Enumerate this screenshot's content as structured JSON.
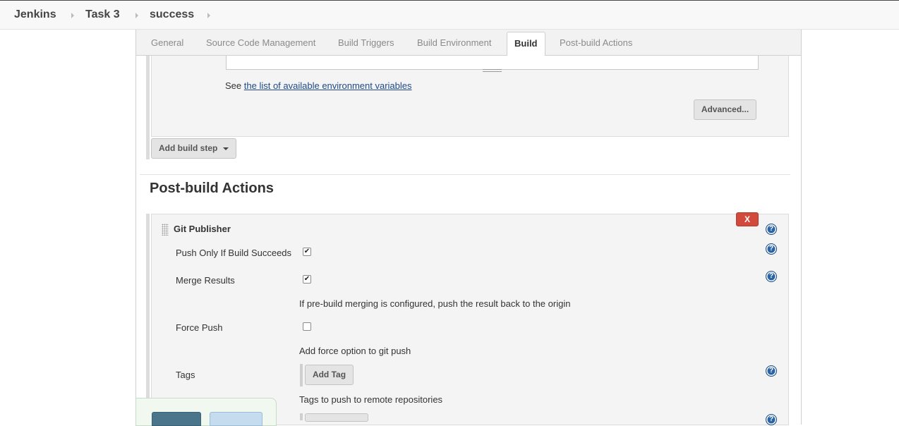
{
  "breadcrumb": {
    "items": [
      "Jenkins",
      "Task 3",
      "success"
    ]
  },
  "tabs": {
    "items": [
      "General",
      "Source Code Management",
      "Build Triggers",
      "Build Environment",
      "Build",
      "Post-build Actions"
    ],
    "active": "Build"
  },
  "build": {
    "env_see": "See",
    "env_link": "the list of available environment variables",
    "advanced_label": "Advanced...",
    "add_build_step_label": "Add build step"
  },
  "post_build": {
    "title": "Post-build Actions",
    "delete_label": "X",
    "publisher": {
      "title": "Git Publisher",
      "push_only_label": "Push Only If Build Succeeds",
      "push_only_checked": true,
      "merge_results_label": "Merge Results",
      "merge_results_checked": true,
      "merge_help": "If pre-build merging is configured, push the result back to the origin",
      "force_push_label": "Force Push",
      "force_push_checked": false,
      "force_push_help": "Add force option to git push",
      "tags_label": "Tags",
      "add_tag_label": "Add Tag",
      "tags_help": "Tags to push to remote repositories"
    }
  },
  "colors": {
    "link": "#204a87",
    "delete": "#d24a3c",
    "help": "#2a64a4",
    "save": "#4b758b",
    "apply": "#c5dbee"
  },
  "icons": {
    "breadcrumb_separator": "chevron-right-icon",
    "help": "help-icon",
    "dropdown": "caret-down-icon",
    "drag": "drag-handle-icon",
    "checkbox_checked": "check-icon"
  }
}
